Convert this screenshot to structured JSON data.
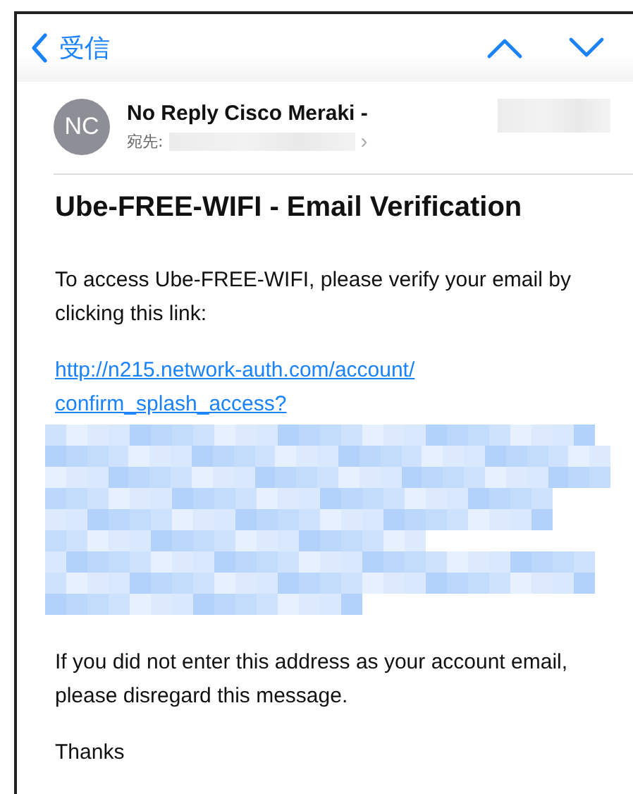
{
  "nav": {
    "back_label": "受信"
  },
  "message": {
    "avatar_initials": "NC",
    "sender": "No Reply Cisco Meraki -",
    "to_label": "宛先:",
    "chevron": "›"
  },
  "subject": "Ube-FREE-WIFI - Email Verification",
  "body": [
    {
      "kind": "text",
      "text": "To access Ube-FREE-WIFI, please verify your email by clicking this link:"
    },
    {
      "kind": "link",
      "text": "http://n215.network-auth.com/account/ confirm_splash_access?"
    },
    {
      "kind": "redacted"
    },
    {
      "kind": "text",
      "text": "If you did not enter this address as your account email, please disregard this message."
    },
    {
      "kind": "text",
      "text": "Thanks"
    }
  ]
}
